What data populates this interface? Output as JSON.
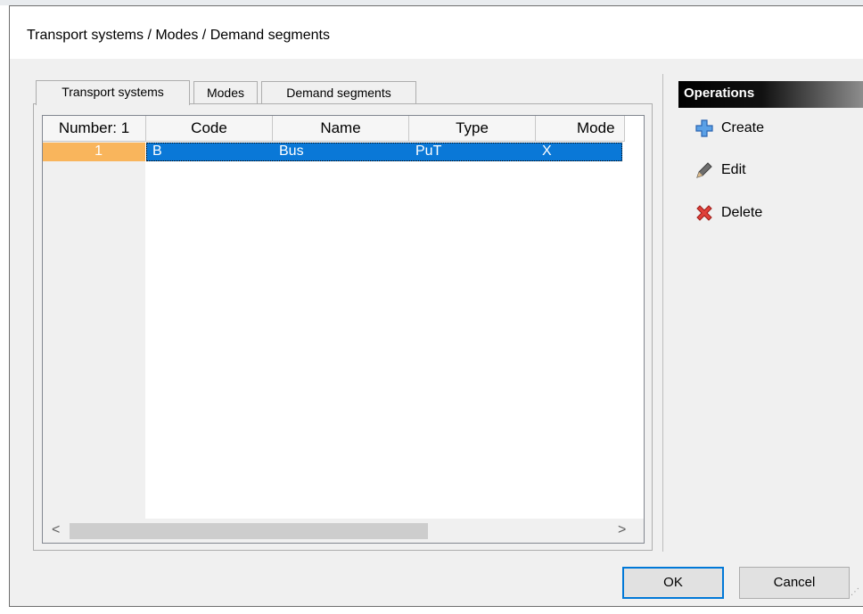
{
  "window": {
    "title": "Transport systems / Modes / Demand segments"
  },
  "tabs": [
    {
      "label": "Transport systems"
    },
    {
      "label": "Modes"
    },
    {
      "label": "Demand segments"
    }
  ],
  "grid": {
    "columns": [
      "Number: 1",
      "Code",
      "Name",
      "Type",
      "Mode"
    ],
    "rows": [
      {
        "number": "1",
        "code": "B",
        "name": "Bus",
        "type": "PuT",
        "mode": "X"
      }
    ]
  },
  "operations": {
    "header": "Operations",
    "items": [
      {
        "label": "Create",
        "icon": "plus-icon"
      },
      {
        "label": "Edit",
        "icon": "pencil-icon"
      },
      {
        "label": "Delete",
        "icon": "delete-x-icon"
      }
    ]
  },
  "buttons": {
    "ok": "OK",
    "cancel": "Cancel"
  },
  "scrollbar": {
    "left_arrow": "<",
    "right_arrow": ">"
  },
  "colors": {
    "selection": "#0a78d7",
    "row_number_highlight": "#f9b55c",
    "ok_border": "#0078d7"
  }
}
